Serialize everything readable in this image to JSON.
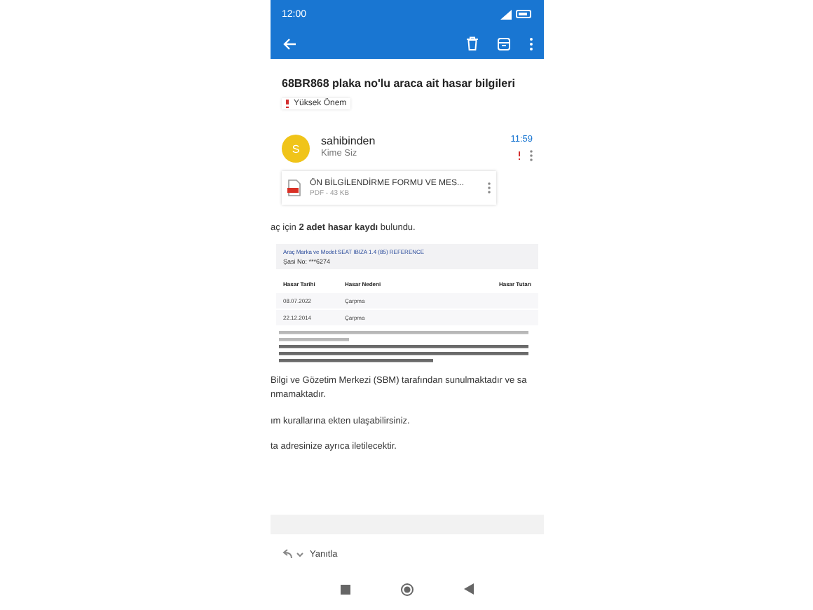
{
  "status_bar": {
    "time": "12:00"
  },
  "subject": "68BR868 plaka no'lu araca ait hasar bilgileri",
  "importance": {
    "label": "Yüksek Önem"
  },
  "message": {
    "avatar_letter": "S",
    "sender": "sahibinden",
    "recipient": "Kime Siz",
    "time": "11:59",
    "important": true
  },
  "attachment": {
    "name": "ÖN BİLGİLENDİRME FORMU VE MES...",
    "meta": "PDF - 43 KB"
  },
  "body": {
    "intro": "aç için **2 adet hasar kaydı** bulundu.",
    "report": {
      "vehicle": "Araç Marka ve Model:SEAT IBIZA 1.4 (85) REFERENCE",
      "chassis": "Şasi No: ***6274",
      "columns": [
        "Hasar Tarihi",
        "Hasar Nedeni",
        "Hasar Tutarı"
      ],
      "rows": [
        [
          "08.07.2022",
          "Çarpma"
        ],
        [
          "22.12.2014",
          "Çarpma"
        ]
      ]
    },
    "paragraphs": [
      "Bilgi ve Gözetim Merkezi (SBM) tarafından sunulmaktadır ve sa\nnmamaktadır.",
      "ım kurallarına ekten ulaşabilirsiniz.",
      "ta adresinize ayrıca iletilecektir."
    ]
  },
  "reply": {
    "label": "Yanıtla"
  }
}
